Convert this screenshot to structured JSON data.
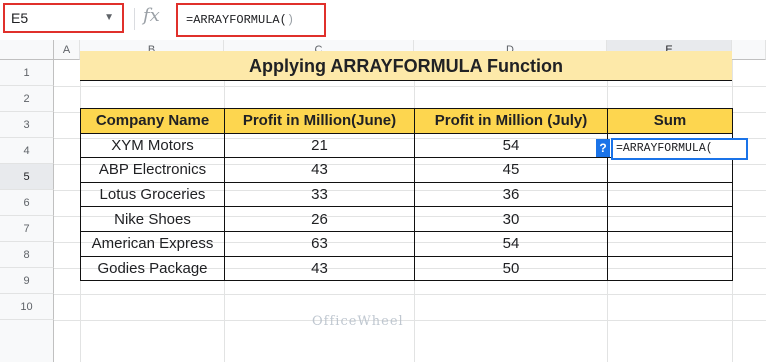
{
  "formula_bar": {
    "name_box": "E5",
    "fx_label": "fx",
    "formula": "=ARRAYFORMULA(",
    "formula_close": ")"
  },
  "columns": [
    "A",
    "B",
    "C",
    "D",
    "E"
  ],
  "rows": [
    "1",
    "2",
    "3",
    "4",
    "5",
    "6",
    "7",
    "8",
    "9",
    "10"
  ],
  "title": "Applying ARRAYFORMULA Function",
  "table": {
    "headers": [
      "Company Name",
      "Profit in Million(June)",
      "Profit in Million (July)",
      "Sum"
    ],
    "rows": [
      [
        "XYM Motors",
        "21",
        "54",
        ""
      ],
      [
        "ABP Electronics",
        "43",
        "45",
        ""
      ],
      [
        "Lotus Groceries",
        "33",
        "36",
        ""
      ],
      [
        "Nike Shoes",
        "26",
        "30",
        ""
      ],
      [
        "American Express",
        "63",
        "54",
        ""
      ],
      [
        "Godies Package",
        "43",
        "50",
        ""
      ]
    ]
  },
  "active_cell": {
    "help": "?",
    "text": "=ARRAYFORMULA("
  },
  "watermark": "OfficeWheel",
  "colors": {
    "header_fill": "#fdd64f",
    "title_fill": "#fde9a9",
    "highlight_border": "#e0302b",
    "active_border": "#1a73e8"
  }
}
